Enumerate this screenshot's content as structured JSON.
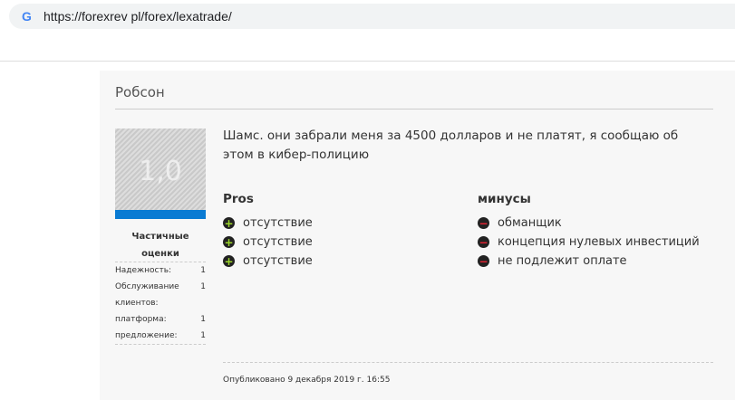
{
  "browser": {
    "url": "https://forexrev pl/forex/lexatrade/"
  },
  "review": {
    "author": "Робсон",
    "score": "1,0",
    "score_fraction": 0.2,
    "partial_title": "Частичные оценки",
    "ratings": [
      {
        "label": "Надежность:",
        "value": "1"
      },
      {
        "label": "Обслуживание клиентов:",
        "value": "1"
      },
      {
        "label": "платформа:",
        "value": "1"
      },
      {
        "label": "предложение:",
        "value": "1"
      }
    ],
    "text": "Шамс. они забрали меня за 4500 долларов и не платят, я сообщаю об этом в кибер-полицию",
    "pros_title": "Pros",
    "pros": [
      "отсутствие",
      "отсутствие",
      "отсутствие"
    ],
    "cons_title": "минусы",
    "cons": [
      "обманщик",
      "концепция нулевых инвестиций",
      "не подлежит оплате"
    ],
    "published": "Опубликовано 9 декабря 2019 г. 16:55"
  }
}
